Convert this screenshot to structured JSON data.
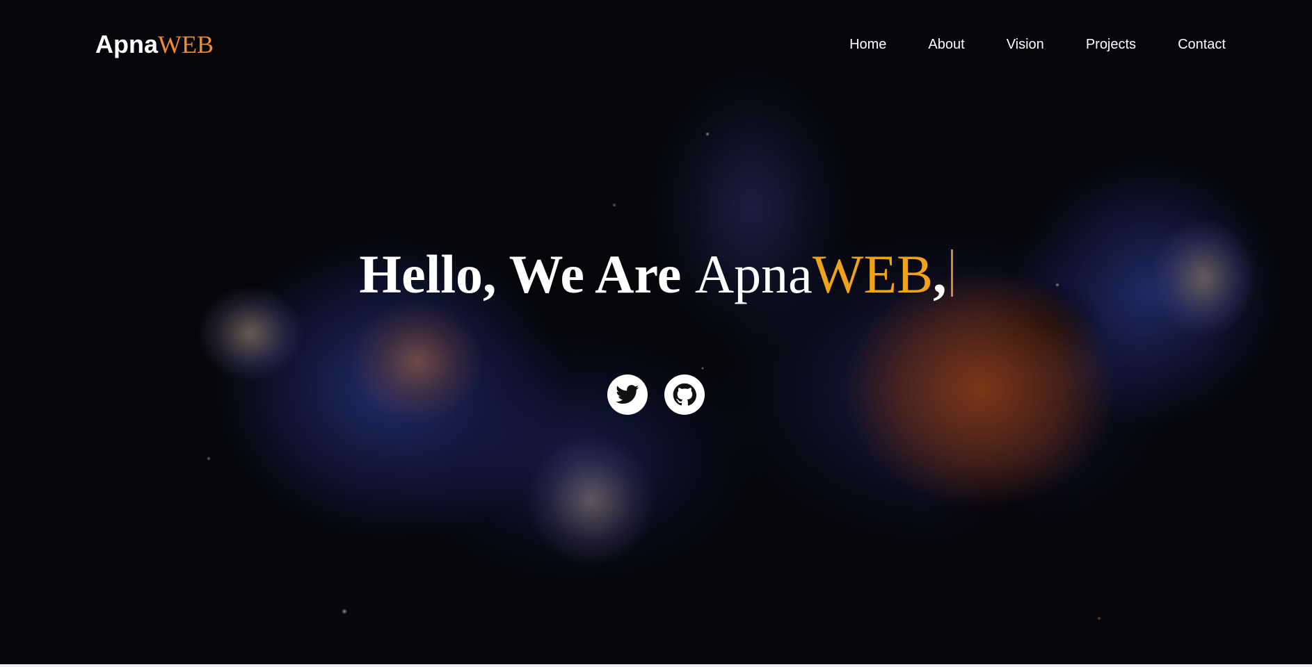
{
  "brand": {
    "name_main": "Apna",
    "name_accent": "WEB",
    "accent_color": "#f08a33"
  },
  "nav": {
    "items": [
      {
        "label": "Home"
      },
      {
        "label": "About"
      },
      {
        "label": "Vision"
      },
      {
        "label": "Projects"
      },
      {
        "label": "Contact"
      }
    ]
  },
  "hero": {
    "text_bold": "Hello, We Are",
    "text_apna": "Apna",
    "text_accent": "WEB",
    "text_trail": ",",
    "accent_color": "#f0a31a"
  },
  "social": {
    "items": [
      {
        "icon": "twitter-icon"
      },
      {
        "icon": "github-icon"
      }
    ]
  },
  "colors": {
    "text": "#ffffff",
    "background": "#07090d"
  }
}
